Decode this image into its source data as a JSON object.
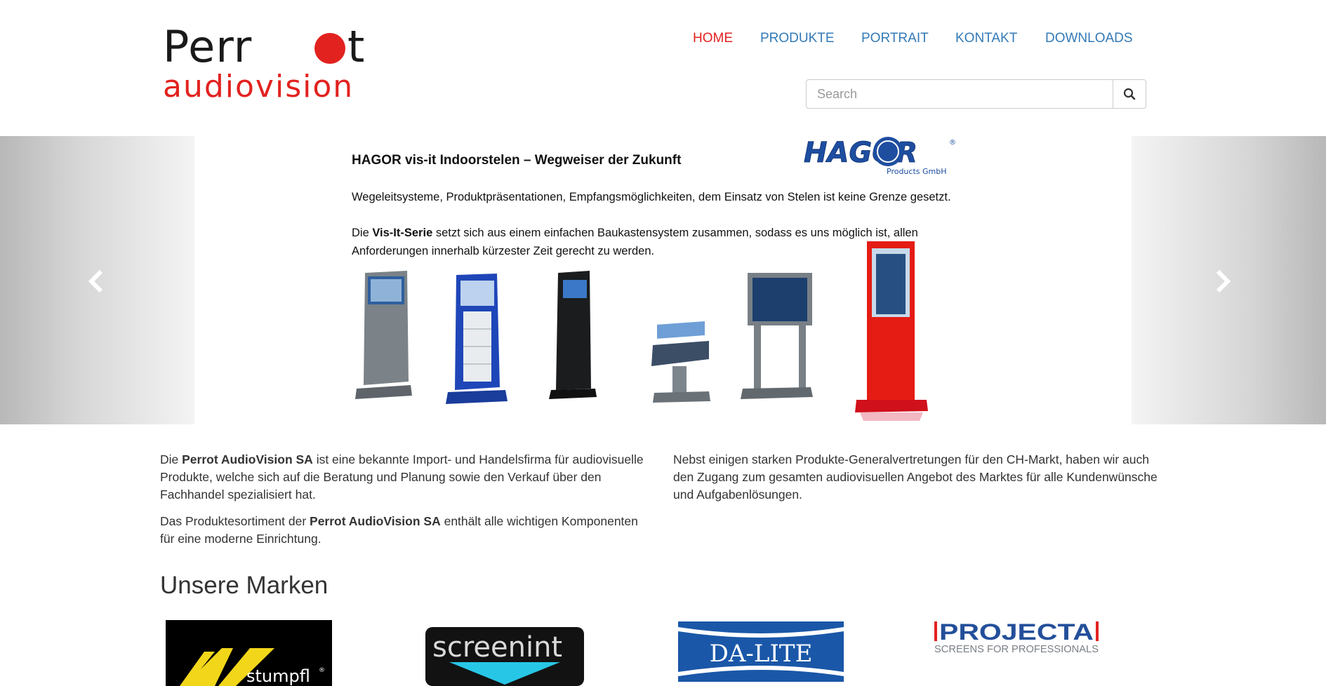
{
  "logo": {
    "line1": "Perr",
    "line1b": "t",
    "line2": "audiovision"
  },
  "nav": {
    "items": [
      {
        "label": "HOME",
        "active": true
      },
      {
        "label": "PRODUKTE",
        "active": false
      },
      {
        "label": "PORTRAIT",
        "active": false
      },
      {
        "label": "KONTAKT",
        "active": false
      },
      {
        "label": "DOWNLOADS",
        "active": false
      }
    ]
  },
  "search": {
    "placeholder": "Search",
    "icon": "search-icon"
  },
  "carousel": {
    "slide": {
      "title": "HAGOR vis-it Indoorstelen – Wegweiser der Zukunft",
      "p1": "Wegeleitsysteme, Produktpräsentationen, Empfangsmöglichkeiten, dem Einsatz von Stelen ist keine Grenze gesetzt.",
      "p2_prefix": "Die ",
      "p2_bold": "Vis-It-Serie",
      "p2_suffix": " setzt sich aus einem einfachen Baukastensystem zusammen, sodass  es uns möglich ist, allen",
      "p3": "Anforderungen innerhalb kürzester Zeit gerecht zu werden.",
      "brand_logo_text": "HAGOR",
      "brand_logo_sub": "Products GmbH"
    },
    "indicators": [
      false,
      false,
      true,
      false,
      false
    ],
    "prev_icon": "chevron-left-icon",
    "next_icon": "chevron-right-icon"
  },
  "intro": {
    "left_p1_a": "Die ",
    "left_p1_b": "Perrot AudioVision SA",
    "left_p1_c": " ist eine bekannte Import- und Handelsfirma für audiovisuelle Produkte, welche sich auf die Beratung und Planung sowie den Verkauf über den Fachhandel spezialisiert hat.",
    "left_p2_a": "Das Produktesortiment der ",
    "left_p2_b": "Perrot AudioVision SA",
    "left_p2_c": " enthält alle wichtigen Komponenten für eine moderne Einrichtung.",
    "right_p1": "Nebst einigen starken Produkte-Generalvertretungen für den CH-Markt, haben wir auch den Zugang zum gesamten audiovisuellen Angebot des Marktes für alle Kundenwünsche und Aufgabenlösungen."
  },
  "brands": {
    "title": "Unsere Marken",
    "items": [
      {
        "name": "stumpfl",
        "text": "stumpfl"
      },
      {
        "name": "screenint",
        "text": "screenint"
      },
      {
        "name": "da-lite",
        "text": "DA-LITE"
      },
      {
        "name": "projecta",
        "text": "PROJECTA",
        "sub": "SCREENS FOR PROFESSIONALS"
      }
    ]
  },
  "colors": {
    "brand_red": "#e2221f",
    "link_blue": "#337ab7",
    "text": "#333333"
  }
}
